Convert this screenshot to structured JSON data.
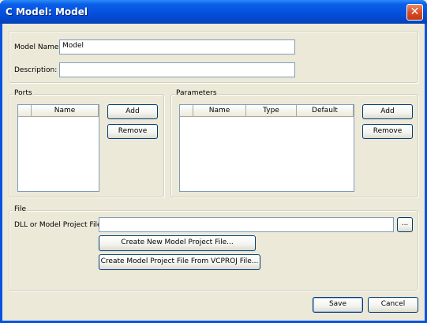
{
  "window": {
    "title": "C Model: Model",
    "close_glyph": "✕"
  },
  "model": {
    "name_label": "Model Name:",
    "name_value": "Model",
    "description_label": "Description:",
    "description_value": ""
  },
  "ports": {
    "legend": "Ports",
    "columns": [
      "",
      "Name"
    ],
    "add_label": "Add",
    "remove_label": "Remove"
  },
  "parameters": {
    "legend": "Parameters",
    "columns": [
      "",
      "Name",
      "Type",
      "Default"
    ],
    "add_label": "Add",
    "remove_label": "Remove"
  },
  "file": {
    "legend": "File",
    "path_label": "DLL or Model Project File:",
    "path_value": "",
    "browse_label": "...",
    "create_new_label": "Create New Model Project File...",
    "create_from_label": "Create Model Project File From VCPROJ File..."
  },
  "footer": {
    "save_label": "Save",
    "cancel_label": "Cancel"
  }
}
